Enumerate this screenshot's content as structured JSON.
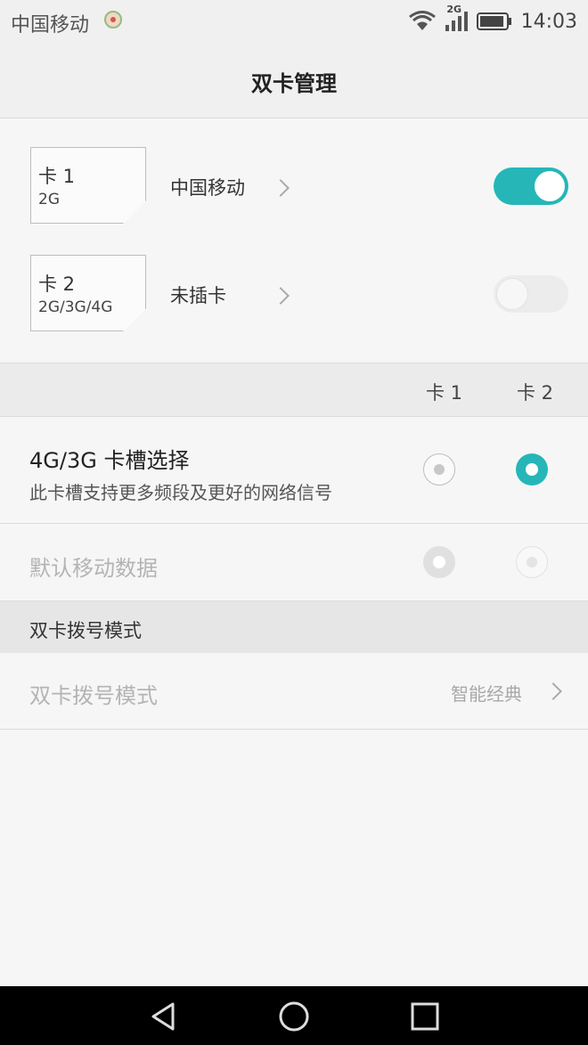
{
  "status": {
    "carrier": "中国移动",
    "network": "2G",
    "time": "14:03",
    "icons": [
      "carrier-badge-icon",
      "wifi-icon",
      "signal-icon",
      "battery-icon"
    ]
  },
  "header": {
    "title": "双卡管理"
  },
  "sims": [
    {
      "name": "卡 1",
      "bands": "2G",
      "carrier": "中国移动",
      "enabled": true
    },
    {
      "name": "卡 2",
      "bands": "2G/3G/4G",
      "carrier": "未插卡",
      "enabled": false
    }
  ],
  "columns": {
    "card1": "卡 1",
    "card2": "卡 2"
  },
  "slot_select": {
    "title": "4G/3G 卡槽选择",
    "subtitle": "此卡槽支持更多频段及更好的网络信号",
    "selected": "卡 2"
  },
  "default_data": {
    "title": "默认移动数据",
    "enabled": false
  },
  "dial_mode": {
    "section_title": "双卡拨号模式",
    "row_label": "双卡拨号模式",
    "value": "智能经典"
  },
  "colors": {
    "accent": "#26b6b8",
    "disabled_text": "#b4b4b4"
  }
}
